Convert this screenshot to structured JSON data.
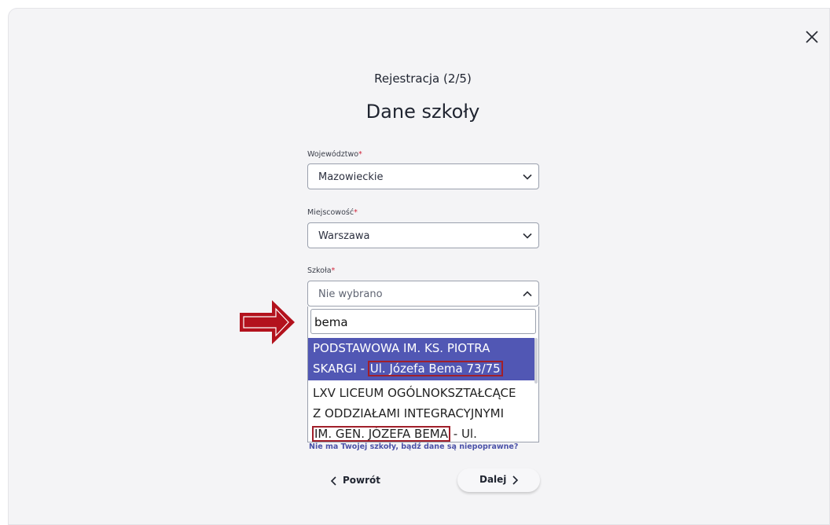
{
  "header": {
    "step": "Rejestracja (2/5)",
    "title": "Dane szkoły"
  },
  "fields": {
    "voivodeship": {
      "label": "Województwo",
      "required": "*",
      "value": "Mazowieckie"
    },
    "city": {
      "label": "Miejscowość",
      "required": "*",
      "value": "Warszawa"
    },
    "school": {
      "label": "Szkoła",
      "required": "*",
      "placeholder": "Nie wybrano"
    }
  },
  "dropdown": {
    "search_value": "bema",
    "options": [
      {
        "line1": "PODSTAWOWA IM. KS. PIOTRA",
        "line2_pre": "SKARGI - ",
        "line2_hl": "Ul. Józefa Bema 73/75"
      },
      {
        "line1": "LXV LICEUM OGÓLNOKSZTAŁCĄCE",
        "line2": "Z ODDZIAŁAMI INTEGRACYJNYMI",
        "line3_hl": "IM. GEN. JÓZEFA BEMA",
        "line3_post": " - Ul."
      }
    ]
  },
  "links": {
    "missing_school": "Nie ma Twojej szkoły, bądź dane są niepoprawne?"
  },
  "buttons": {
    "back": "Powrót",
    "next": "Dalej"
  },
  "icons": {
    "close": "close-icon",
    "chevron": "chevron-down-icon",
    "arrow": "arrow-right-icon"
  },
  "colors": {
    "accent": "#5157b4",
    "highlight_box": "#a11f2a",
    "arrow": "#b3121d"
  }
}
